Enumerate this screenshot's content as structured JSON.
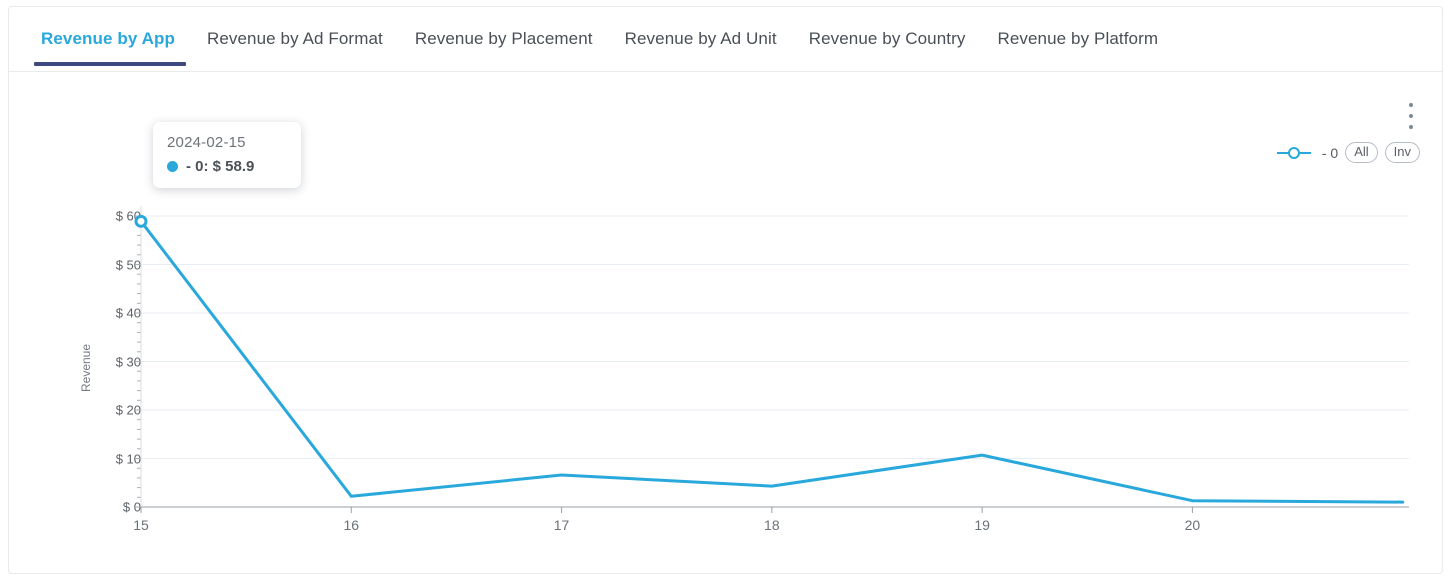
{
  "tabs": [
    {
      "label": "Revenue by App",
      "active": true
    },
    {
      "label": "Revenue by Ad Format",
      "active": false
    },
    {
      "label": "Revenue by Placement",
      "active": false
    },
    {
      "label": "Revenue by Ad Unit",
      "active": false
    },
    {
      "label": "Revenue by Country",
      "active": false
    },
    {
      "label": "Revenue by Platform",
      "active": false
    }
  ],
  "toolbar": {
    "menu_icon": "kebab-menu-icon"
  },
  "legend": {
    "series_label": "- 0",
    "all_button": "All",
    "inv_button": "Inv",
    "marker_icon": "line-circle-marker-icon"
  },
  "tooltip": {
    "date": "2024-02-15",
    "series_label": "- 0",
    "value": "$ 58.9",
    "row_text": "- 0: $ 58.9",
    "marker_icon": "series-dot-icon"
  },
  "colors": {
    "accent": "#29a8dc",
    "active_tab_underline": "#3c4a81",
    "grid": "#e8ecf3",
    "axis": "#9aa0a6",
    "text": "#4a4f57"
  },
  "chart_data": {
    "type": "line",
    "title": "",
    "xlabel": "",
    "ylabel": "Revenue",
    "x": [
      15,
      16,
      17,
      18,
      19,
      20,
      21
    ],
    "xtick_labels": [
      "15",
      "16",
      "17",
      "18",
      "19",
      "20"
    ],
    "ytick_labels": [
      "$ 0",
      "$ 10",
      "$ 20",
      "$ 30",
      "$ 40",
      "$ 50",
      "$ 60"
    ],
    "ytick_values": [
      0,
      10,
      20,
      30,
      40,
      50,
      60
    ],
    "ylim": [
      0,
      60
    ],
    "xlim": [
      15,
      21.03
    ],
    "grid": true,
    "legend_position": "top-right",
    "series": [
      {
        "name": "- 0",
        "color": "#29a8dc",
        "values": [
          58.9,
          2.2,
          6.6,
          4.3,
          10.7,
          1.3,
          1.0
        ]
      }
    ],
    "annotations": [
      {
        "type": "tooltip",
        "x": 15,
        "y": 58.9,
        "date": "2024-02-15",
        "text": "- 0: $ 58.9"
      }
    ]
  }
}
